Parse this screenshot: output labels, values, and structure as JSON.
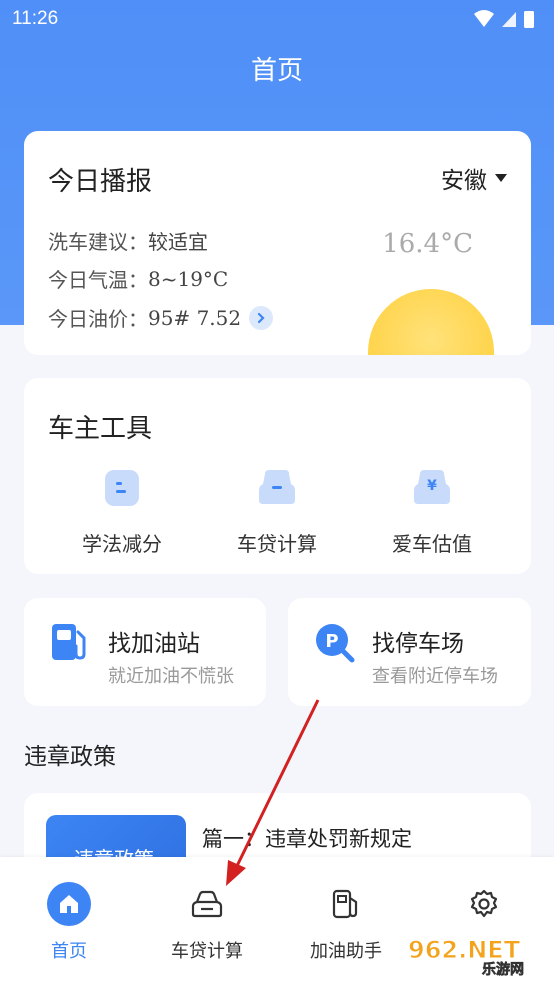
{
  "status_bar": {
    "time": "11:26"
  },
  "header": {
    "title": "首页"
  },
  "broadcast": {
    "title": "今日播报",
    "region": "安徽",
    "temperature_display": "16.4°C",
    "rows": [
      {
        "label": "洗车建议：",
        "value": "较适宜"
      },
      {
        "label": "今日气温：",
        "value": "8~19°C"
      },
      {
        "label": "今日油价：",
        "value": "95# 7.52"
      }
    ]
  },
  "tools": {
    "title": "车主工具",
    "items": [
      {
        "label": "学法减分",
        "icon": "study-icon"
      },
      {
        "label": "车贷计算",
        "icon": "car-loan-icon"
      },
      {
        "label": "爱车估值",
        "icon": "car-value-icon"
      }
    ]
  },
  "quick": [
    {
      "title": "找加油站",
      "subtitle": "就近加油不慌张",
      "icon": "gas-station-icon"
    },
    {
      "title": "找停车场",
      "subtitle": "查看附近停车场",
      "icon": "parking-search-icon"
    }
  ],
  "policy": {
    "section_title": "违章政策",
    "thumb_text": "违章政策",
    "first_title": "篇一：违章处罚新规定"
  },
  "tabbar": {
    "tabs": [
      {
        "label": "首页",
        "icon": "home-icon",
        "active": true
      },
      {
        "label": "车贷计算",
        "icon": "car-icon",
        "active": false
      },
      {
        "label": "加油助手",
        "icon": "fuel-icon",
        "active": false
      },
      {
        "label": "",
        "icon": "settings-icon",
        "active": false
      }
    ]
  },
  "colors": {
    "primary": "#3d85f4",
    "header_bg": "#5a97f8",
    "sun": "#ffd54f",
    "arrow": "#d32020"
  },
  "watermark": {
    "text": "962.NET",
    "subtext": "乐游网"
  }
}
